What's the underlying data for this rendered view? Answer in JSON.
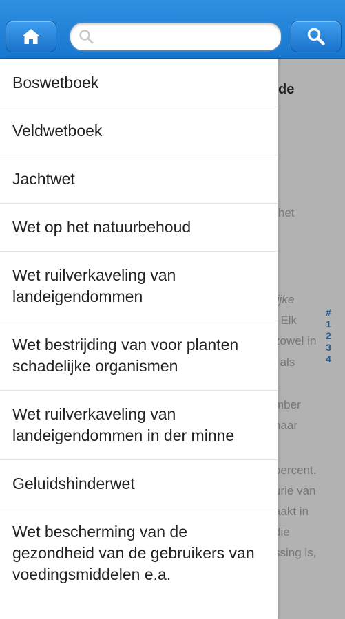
{
  "toolbar": {
    "home_icon": "home-icon",
    "search_icon": "search-icon",
    "search_placeholder": ""
  },
  "background_page": {
    "fragments": [
      "de",
      "het",
      "lijke",
      ". Elk",
      "zowel in",
      "l als",
      "mber",
      "naar",
      "percent.",
      "urie van",
      "aakt in",
      "die",
      "ssing is,"
    ],
    "index_links": [
      "#",
      "1",
      "2",
      "3",
      "4"
    ]
  },
  "menu": {
    "items": [
      {
        "label": "Boswetboek"
      },
      {
        "label": "Veldwetboek"
      },
      {
        "label": "Jachtwet"
      },
      {
        "label": "Wet op het natuurbehoud"
      },
      {
        "label": "Wet ruilverkaveling van landeigendommen"
      },
      {
        "label": "Wet bestrijding van voor planten schadelijke organismen"
      },
      {
        "label": "Wet ruilverkaveling van landeigendommen in der minne"
      },
      {
        "label": "Geluidshinderwet"
      },
      {
        "label": "Wet bescherming van de gezondheid van de gebruikers van voedingsmiddelen e.a."
      }
    ]
  },
  "colors": {
    "toolbar": "#1e7fd6",
    "overlay": "#b2b2b2",
    "index_link": "#2a5d8f"
  }
}
